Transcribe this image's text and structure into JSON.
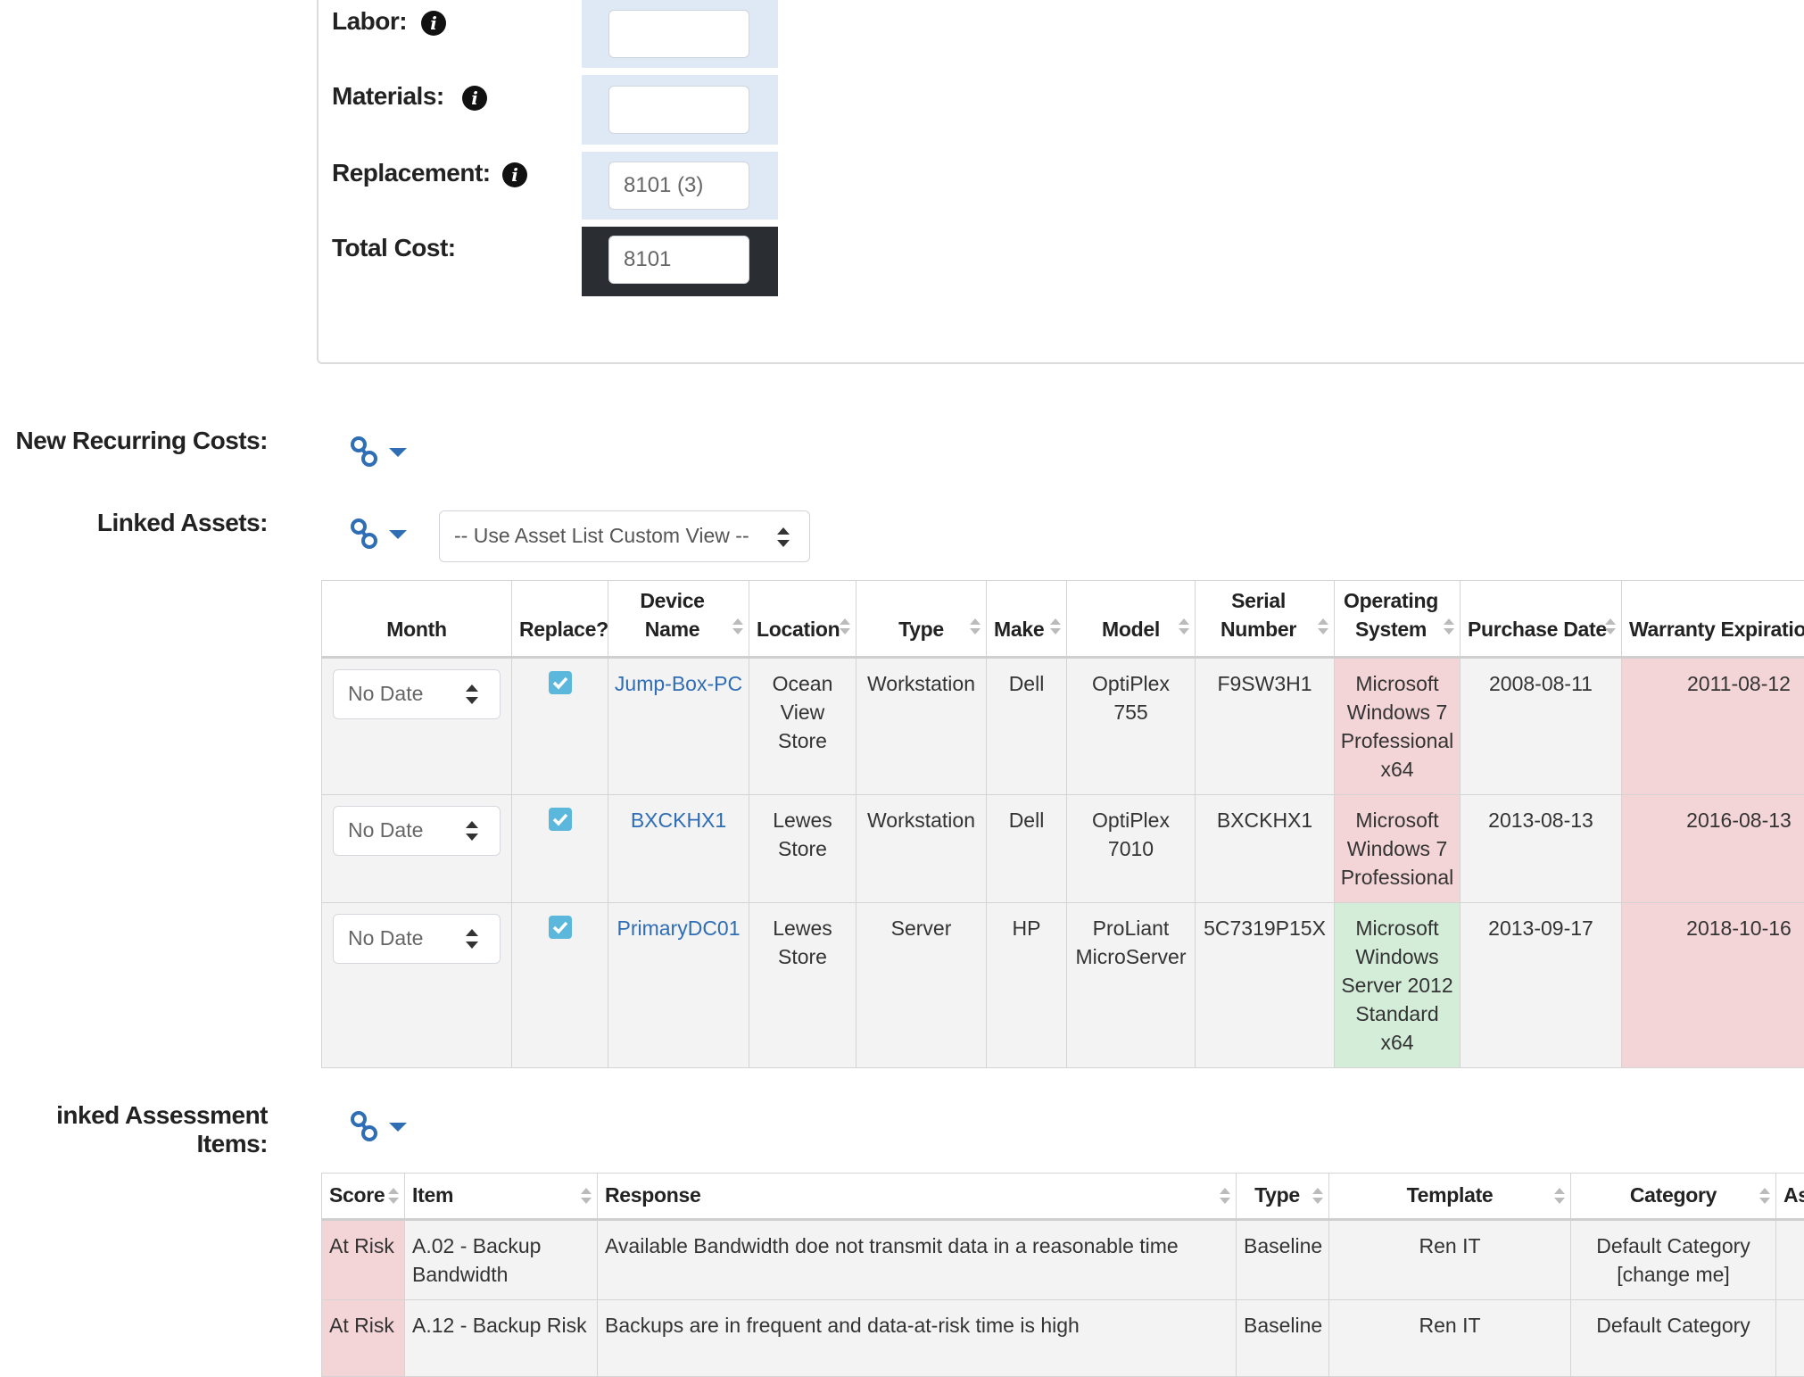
{
  "costs": {
    "labor_label": "Labor:",
    "materials_label": "Materials:",
    "replacement_label": "Replacement:",
    "replacement_value": "8101 (3)",
    "total_label": "Total Cost:",
    "total_value": "8101"
  },
  "sections": {
    "recurring_label": "New Recurring Costs:",
    "linked_assets_label": "Linked Assets:",
    "linked_assessment_label": "inked Assessment Items:",
    "asset_view_select": "-- Use Asset List Custom View --"
  },
  "asset_columns": [
    "Month",
    "Replace?",
    "Device Name",
    "Location",
    "Type",
    "Make",
    "Model",
    "Serial Number",
    "Operating System",
    "Purchase Date",
    "Warranty Expiration"
  ],
  "assets": [
    {
      "month": "No Date",
      "replace": true,
      "device": "Jump-Box-PC",
      "location": "Ocean View Store",
      "type": "Workstation",
      "make": "Dell",
      "model": "OptiPlex 755",
      "serial": "F9SW3H1",
      "os": "Microsoft Windows 7 Professional x64",
      "purchase": "2008-08-11",
      "warranty": "2011-08-12"
    },
    {
      "month": "No Date",
      "replace": true,
      "device": "BXCKHX1",
      "location": "Lewes Store",
      "type": "Workstation",
      "make": "Dell",
      "model": "OptiPlex 7010",
      "serial": "BXCKHX1",
      "os": "Microsoft Windows 7 Professional",
      "purchase": "2013-08-13",
      "warranty": "2016-08-13"
    },
    {
      "month": "No Date",
      "replace": true,
      "device": "PrimaryDC01",
      "location": "Lewes Store",
      "type": "Server",
      "make": "HP",
      "model": "ProLiant MicroServer",
      "serial": "5C7319P15X",
      "os": "Microsoft Windows Server 2012 Standard x64",
      "purchase": "2013-09-17",
      "warranty": "2018-10-16"
    }
  ],
  "assessment_columns": [
    "Score",
    "Item",
    "Response",
    "Type",
    "Template",
    "Category",
    "As"
  ],
  "assessment_items": [
    {
      "score": "At Risk",
      "item": "A.02 - Backup Bandwidth",
      "response": "Available Bandwidth doe not transmit data in a reasonable time",
      "type": "Baseline",
      "template": "Ren IT",
      "category": "Default Category [change me]"
    },
    {
      "score": "At Risk",
      "item": "A.12 - Backup Risk",
      "response": "Backups are in frequent and data-at-risk time is high",
      "type": "Baseline",
      "template": "Ren IT",
      "category": "Default Category"
    }
  ],
  "colors": {
    "link": "#2f6db5",
    "risk": "#f4d5d7",
    "ok": "#d3edd9",
    "check": "#5bb8dc"
  }
}
